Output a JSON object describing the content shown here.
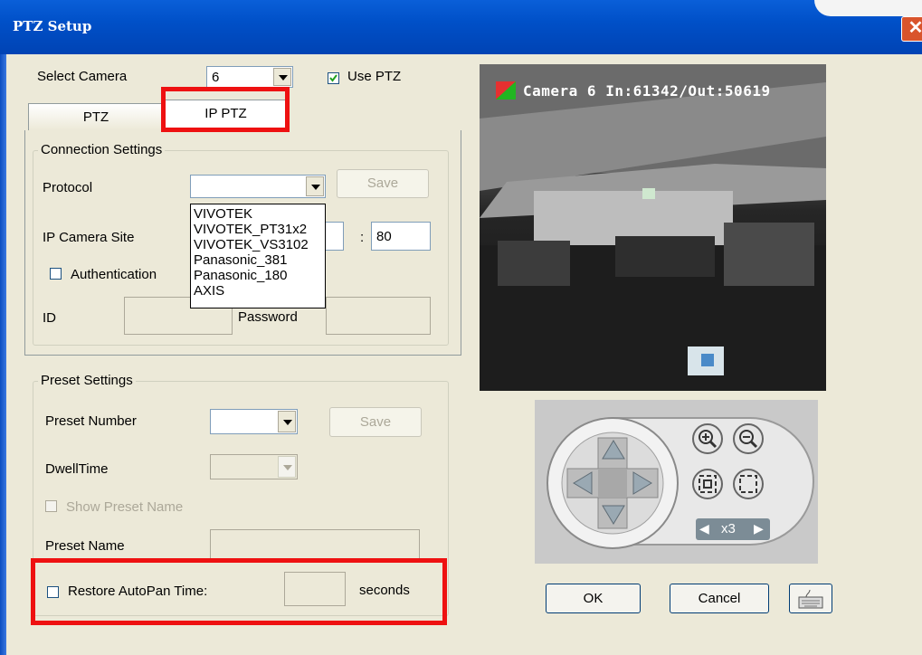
{
  "window": {
    "title": "PTZ Setup",
    "close_symbol": "✕"
  },
  "camera_select": {
    "label": "Select Camera",
    "value": "6",
    "use_ptz_label": "Use PTZ",
    "use_ptz_checked": true
  },
  "tabs": [
    {
      "label": "PTZ"
    },
    {
      "label": "IP PTZ"
    }
  ],
  "connection": {
    "legend": "Connection Settings",
    "protocol_label": "Protocol",
    "protocol_value": "",
    "save_label": "Save",
    "ip_site_label": "IP Camera Site",
    "ip_value": "",
    "port_separator": ":",
    "port_value": "80",
    "auth_label": "Authentication",
    "id_label": "ID",
    "password_label": "Password",
    "protocol_options": [
      "VIVOTEK",
      "VIVOTEK_PT31x2",
      "VIVOTEK_VS3102",
      "Panasonic_381",
      "Panasonic_180",
      "AXIS"
    ]
  },
  "preset": {
    "legend": "Preset Settings",
    "number_label": "Preset Number",
    "number_value": "",
    "save_label": "Save",
    "dwell_label": "DwellTime",
    "dwell_value": "",
    "show_name_label": "Show Preset Name",
    "name_label": "Preset Name",
    "name_value": ""
  },
  "autopan": {
    "label": "Restore AutoPan Time:",
    "value": "",
    "unit": "seconds"
  },
  "video": {
    "overlay_text": "Camera 6 In:61342/Out:50619"
  },
  "ptz_pad": {
    "speed_label": "x3"
  },
  "footer": {
    "ok_label": "OK",
    "cancel_label": "Cancel"
  },
  "colors": {
    "titlebar": "#0050c8",
    "highlight": "#ee1111",
    "dialog_bg": "#ece9d8"
  }
}
